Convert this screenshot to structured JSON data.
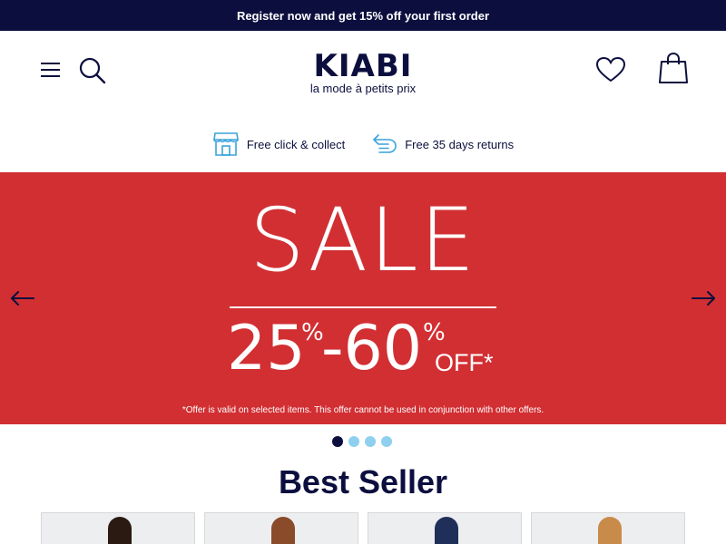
{
  "promo": {
    "text": "Register now and get 15% off your first order"
  },
  "header": {
    "logo_name": "KIABI",
    "logo_tagline": "la mode à petits prix",
    "menu_icon": "menu-icon",
    "search_icon": "search-icon",
    "wishlist_icon": "heart-icon",
    "bag_icon": "shopping-bag-icon"
  },
  "usp": [
    {
      "icon": "store-icon",
      "label": "Free click & collect"
    },
    {
      "icon": "return-icon",
      "label": "Free 35 days returns"
    }
  ],
  "hero": {
    "title": "SALE",
    "discount_from": "25",
    "discount_to": "-60",
    "percent": "%",
    "off": "OFF*",
    "note": "*Offer is valid on selected items. This offer cannot be used in conjunction with other offers.",
    "background": "#d22f33",
    "slides_total": 4,
    "active_slide": 1
  },
  "section": {
    "title": "Best Seller"
  },
  "products": [
    {
      "name": "product-1",
      "hair": "#2b1a12"
    },
    {
      "name": "product-2",
      "hair": "#8a4b2a"
    },
    {
      "name": "product-3",
      "hair": "#1f2f5a"
    },
    {
      "name": "product-4",
      "hair": "#c98b4a"
    }
  ],
  "colors": {
    "navy": "#0c0f3e",
    "accent_blue": "#8fd0ef",
    "sale_red": "#d22f33"
  }
}
